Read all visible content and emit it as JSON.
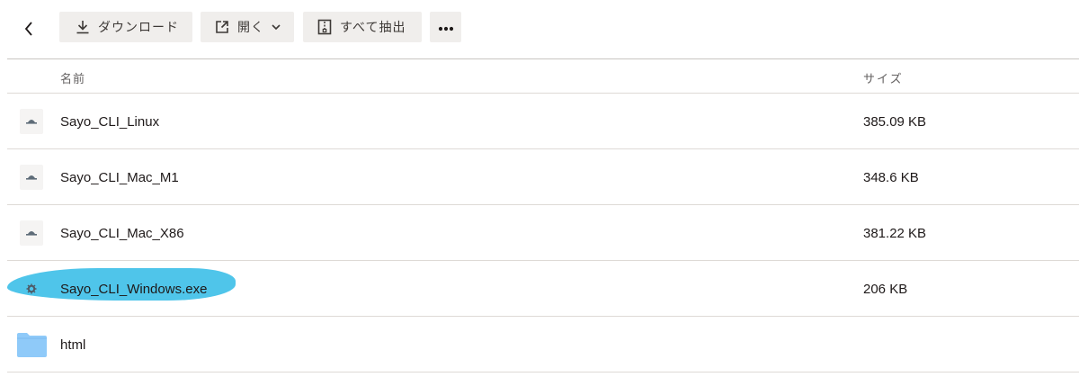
{
  "toolbar": {
    "back_icon": "chevron-left-icon",
    "download_label": "ダウンロード",
    "open_label": "開く",
    "extract_label": "すべて抽出",
    "more_icon": "more-horizontal-icon"
  },
  "table": {
    "col_name": "名前",
    "col_size": "サイズ",
    "rows": [
      {
        "name": "Sayo_CLI_Linux",
        "size": "385.09 KB",
        "icon": "binary-file-icon"
      },
      {
        "name": "Sayo_CLI_Mac_M1",
        "size": "348.6 KB",
        "icon": "binary-file-icon"
      },
      {
        "name": "Sayo_CLI_Mac_X86",
        "size": "381.22 KB",
        "icon": "binary-file-icon"
      },
      {
        "name": "Sayo_CLI_Windows.exe",
        "size": "206 KB",
        "icon": "gear-file-icon",
        "highlighted": true
      },
      {
        "name": "html",
        "size": "",
        "icon": "folder-icon"
      }
    ]
  },
  "colors": {
    "button_bg": "#f0eeec",
    "folder": "#8fcaf9",
    "highlight": "#4fc5ea"
  }
}
